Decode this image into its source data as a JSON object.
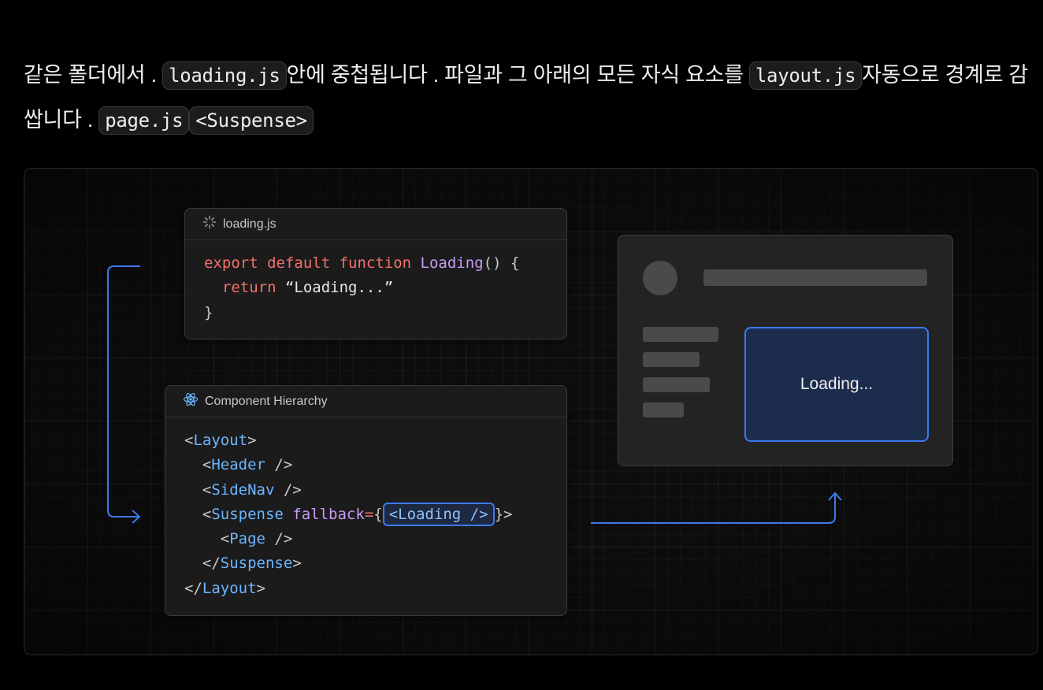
{
  "paragraph": [
    {
      "t": "text",
      "v": "같은 폴더에서 . "
    },
    {
      "t": "code",
      "v": "loading.js"
    },
    {
      "t": "text",
      "v": "안에 중첩됩니다 . 파일과 그 아래의 모든 자식 요소를 "
    },
    {
      "t": "code",
      "v": "layout.js"
    },
    {
      "t": "text",
      "v": "자동으로 경계로 감쌉니다 . "
    },
    {
      "t": "code",
      "v": "page.js"
    },
    {
      "t": "code",
      "v": "<Suspense>"
    }
  ],
  "loading_card": {
    "title": "loading.js",
    "icon": "spinner-icon",
    "lines": [
      [
        {
          "c": "kw",
          "v": "export default function "
        },
        {
          "c": "fn",
          "v": "Loading"
        },
        {
          "c": "pu",
          "v": "() {"
        }
      ],
      [
        {
          "c": "",
          "v": "  "
        },
        {
          "c": "kw",
          "v": "return "
        },
        {
          "c": "",
          "v": "“Loading...”"
        }
      ],
      [
        {
          "c": "pu",
          "v": "}"
        }
      ]
    ]
  },
  "hierarchy_card": {
    "title": "Component Hierarchy",
    "icon": "react-icon",
    "lines": [
      [
        {
          "c": "pu",
          "v": "<"
        },
        {
          "c": "tg",
          "v": "Layout"
        },
        {
          "c": "pu",
          "v": ">"
        }
      ],
      [
        {
          "c": "",
          "v": "  "
        },
        {
          "c": "pu",
          "v": "<"
        },
        {
          "c": "tg",
          "v": "Header"
        },
        {
          "c": "pu",
          "v": " />"
        }
      ],
      [
        {
          "c": "",
          "v": "  "
        },
        {
          "c": "pu",
          "v": "<"
        },
        {
          "c": "tg",
          "v": "SideNav"
        },
        {
          "c": "pu",
          "v": " />"
        }
      ],
      [
        {
          "c": "",
          "v": "  "
        },
        {
          "c": "pu",
          "v": "<"
        },
        {
          "c": "tg",
          "v": "Suspense "
        },
        {
          "c": "at",
          "v": "fallback"
        },
        {
          "c": "kw",
          "v": "="
        },
        {
          "c": "pu",
          "v": "{"
        },
        {
          "c": "hl",
          "v": "<Loading />"
        },
        {
          "c": "pu",
          "v": "}>"
        }
      ],
      [
        {
          "c": "",
          "v": "    "
        },
        {
          "c": "pu",
          "v": "<"
        },
        {
          "c": "tg",
          "v": "Page"
        },
        {
          "c": "pu",
          "v": " />"
        }
      ],
      [
        {
          "c": "",
          "v": "  "
        },
        {
          "c": "pu",
          "v": "</"
        },
        {
          "c": "tg",
          "v": "Suspense"
        },
        {
          "c": "pu",
          "v": ">"
        }
      ],
      [
        {
          "c": "pu",
          "v": "</"
        },
        {
          "c": "tg",
          "v": "Layout"
        },
        {
          "c": "pu",
          "v": ">"
        }
      ]
    ]
  },
  "preview": {
    "loading_text": "Loading..."
  },
  "colors": {
    "accent_blue": "#3c7af0",
    "keyword": "#f47067",
    "function": "#c99bf5",
    "tag": "#6cb6ff"
  }
}
